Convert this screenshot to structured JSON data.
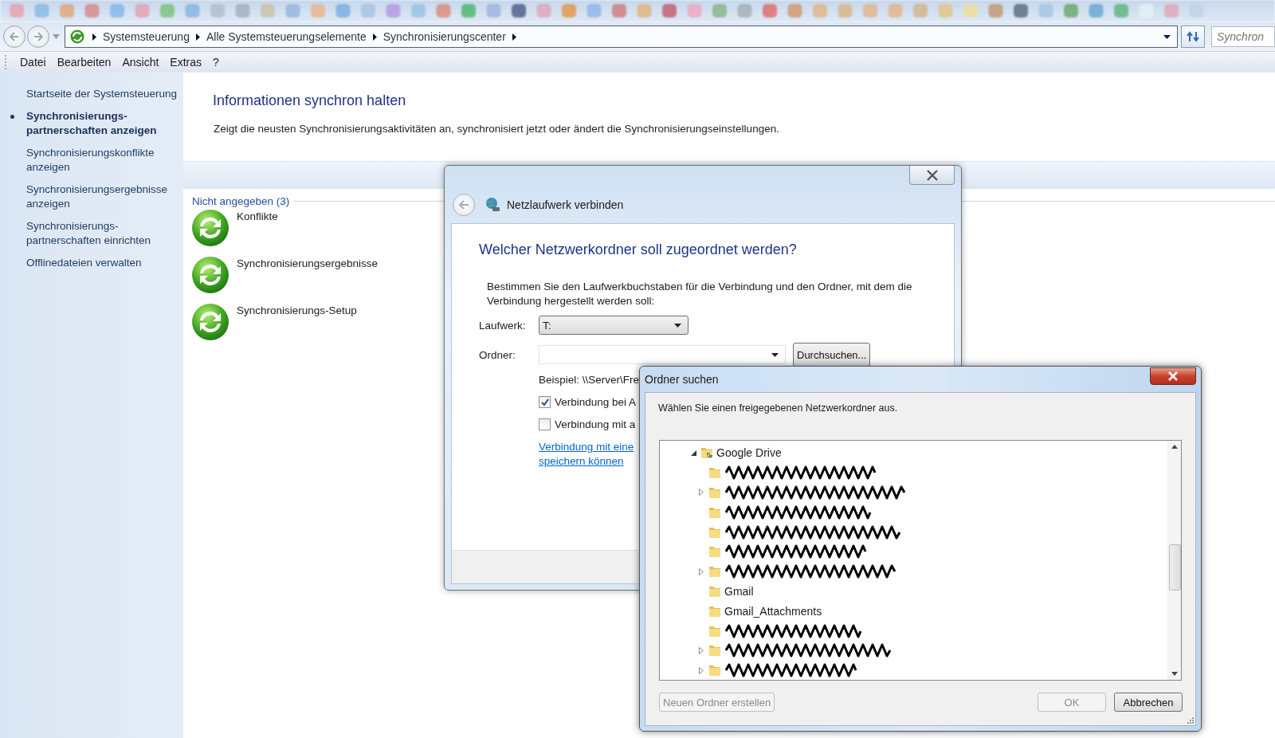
{
  "address_bar": {
    "breadcrumbs": [
      "Systemsteuerung",
      "Alle Systemsteuerungselemente",
      "Synchronisierungscenter"
    ],
    "search": {
      "placeholder": "Synchron"
    }
  },
  "menu": [
    "Datei",
    "Bearbeiten",
    "Ansicht",
    "Extras",
    "?"
  ],
  "sidebar": {
    "items": [
      {
        "label": "Startseite der Systemsteuerung",
        "selected": false
      },
      {
        "label": "Synchronisierungs-\npartnerschaften anzeigen",
        "selected": true
      },
      {
        "label": "Synchronisierungskonflikte\nanzeigen",
        "selected": false
      },
      {
        "label": "Synchronisierungsergebnisse\nanzeigen",
        "selected": false
      },
      {
        "label": "Synchronisierungs-\npartnerschaften einrichten",
        "selected": false
      },
      {
        "label": "Offlinedateien verwalten",
        "selected": false
      }
    ]
  },
  "content": {
    "title": "Informationen synchron halten",
    "description": "Zeigt die neusten Synchronisierungsaktivitäten an, synchronisiert jetzt oder ändert die Synchronisierungseinstellungen.",
    "group": {
      "header": "Nicht angegeben (3)",
      "items": [
        "Konflikte",
        "Synchronisierungsergebnisse",
        "Synchronisierungs-Setup"
      ]
    }
  },
  "map_drive_dialog": {
    "title": "Netzlaufwerk verbinden",
    "heading": "Welcher Netzwerkordner soll zugeordnet werden?",
    "instructions": "Bestimmen Sie den Laufwerkbuchstaben für die Verbindung und den Ordner, mit dem die Verbindung hergestellt werden soll:",
    "drive": {
      "label": "Laufwerk:",
      "value": "T:"
    },
    "folder": {
      "label": "Ordner:"
    },
    "browse_button": "Durchsuchen...",
    "example": "Beispiel: \\\\Server\\Fre",
    "options": [
      {
        "label": "Verbindung bei A",
        "checked": true
      },
      {
        "label": "Verbindung mit a",
        "checked": false
      }
    ],
    "link_lines": [
      "Verbindung mit eine",
      "speichern können"
    ]
  },
  "folder_dialog": {
    "title": "Ordner suchen",
    "prompt": "Wählen Sie einen freigegebenen Netzwerkordner aus.",
    "tree": {
      "label": "Google Drive",
      "kind": "drive",
      "expanded": true,
      "children": [
        {
          "kind": "folder",
          "redacted": true,
          "expandable": false
        },
        {
          "kind": "folder",
          "redacted": true,
          "expandable": true
        },
        {
          "kind": "folder",
          "redacted": true,
          "expandable": false
        },
        {
          "kind": "folder",
          "redacted": true,
          "expandable": false
        },
        {
          "kind": "folder",
          "redacted": true,
          "expandable": false
        },
        {
          "kind": "folder",
          "redacted": true,
          "expandable": true
        },
        {
          "kind": "folder",
          "label": "Gmail",
          "redacted": false,
          "expandable": false
        },
        {
          "kind": "folder",
          "label": "Gmail_Attachments",
          "redacted": false,
          "expandable": false
        },
        {
          "kind": "folder",
          "redacted": true,
          "expandable": false
        },
        {
          "kind": "folder",
          "redacted": true,
          "expandable": true
        },
        {
          "kind": "folder",
          "redacted": true,
          "expandable": true
        }
      ]
    },
    "buttons": [
      {
        "label": "Neuen Ordner erstellen",
        "disabled": true
      },
      {
        "label": "OK",
        "disabled": true
      },
      {
        "label": "Abbrechen",
        "disabled": false
      }
    ]
  }
}
